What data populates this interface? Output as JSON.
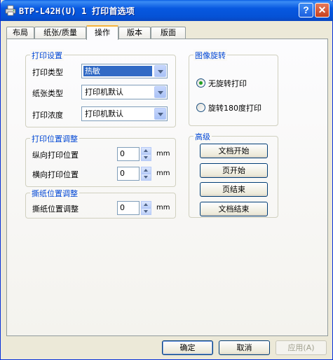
{
  "window": {
    "title": "BTP-L42H(U) 1 打印首选项"
  },
  "tabs": [
    {
      "label": "布局"
    },
    {
      "label": "纸张/质量"
    },
    {
      "label": "操作"
    },
    {
      "label": "版本"
    },
    {
      "label": "版面"
    }
  ],
  "print_settings": {
    "title": "打印设置",
    "type_label": "打印类型",
    "type_value": "热敏",
    "paper_label": "纸张类型",
    "paper_value": "打印机默认",
    "density_label": "打印浓度",
    "density_value": "打印机默认"
  },
  "position_adjust": {
    "title": "打印位置调整",
    "vertical_label": "纵向打印位置",
    "vertical_value": "0",
    "horizontal_label": "横向打印位置",
    "horizontal_value": "0",
    "unit": "mm"
  },
  "tear_adjust": {
    "title": "撕纸位置调整",
    "label": "撕纸位置调整",
    "value": "0",
    "unit": "mm"
  },
  "rotation": {
    "title": "图像旋转",
    "option_none": "无旋转打印",
    "option_180": "旋转180度打印",
    "selected": "none"
  },
  "advanced": {
    "title": "高级",
    "doc_start": "文档开始",
    "page_start": "页开始",
    "page_end": "页结束",
    "doc_end": "文档结束"
  },
  "footer": {
    "ok": "确定",
    "cancel": "取消",
    "apply": "应用(A)"
  },
  "colors": {
    "titlebar": "#0552d6",
    "group_title": "#0046d5",
    "tab_highlight": "#f6b33a"
  }
}
